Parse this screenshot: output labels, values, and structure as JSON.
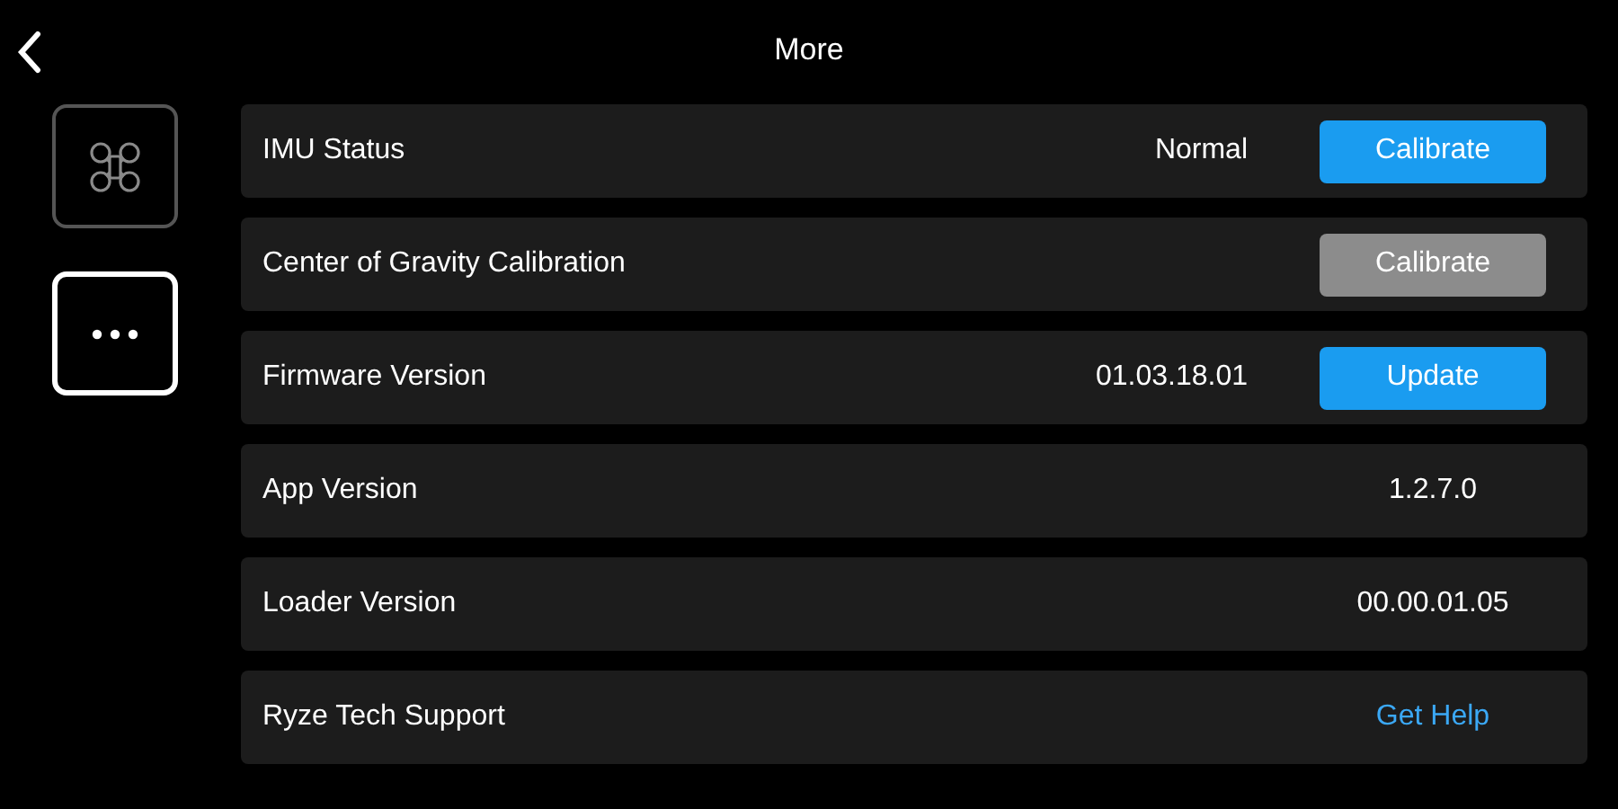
{
  "header": {
    "title": "More"
  },
  "sidebar": {
    "items": [
      {
        "kind": "drone",
        "selected": false
      },
      {
        "kind": "more",
        "selected": true
      }
    ]
  },
  "rows": [
    {
      "label": "IMU Status",
      "value": "Normal",
      "action": {
        "kind": "button",
        "label": "Calibrate",
        "disabled": false
      }
    },
    {
      "label": "Center of Gravity Calibration",
      "action": {
        "kind": "button",
        "label": "Calibrate",
        "disabled": true
      }
    },
    {
      "label": "Firmware Version",
      "value": "01.03.18.01",
      "action": {
        "kind": "button",
        "label": "Update",
        "disabled": false
      }
    },
    {
      "label": "App Version",
      "action": {
        "kind": "text",
        "label": "1.2.7.0"
      }
    },
    {
      "label": "Loader Version",
      "action": {
        "kind": "text",
        "label": "00.00.01.05"
      }
    },
    {
      "label": "Ryze Tech Support",
      "action": {
        "kind": "link",
        "label": "Get Help"
      }
    }
  ]
}
